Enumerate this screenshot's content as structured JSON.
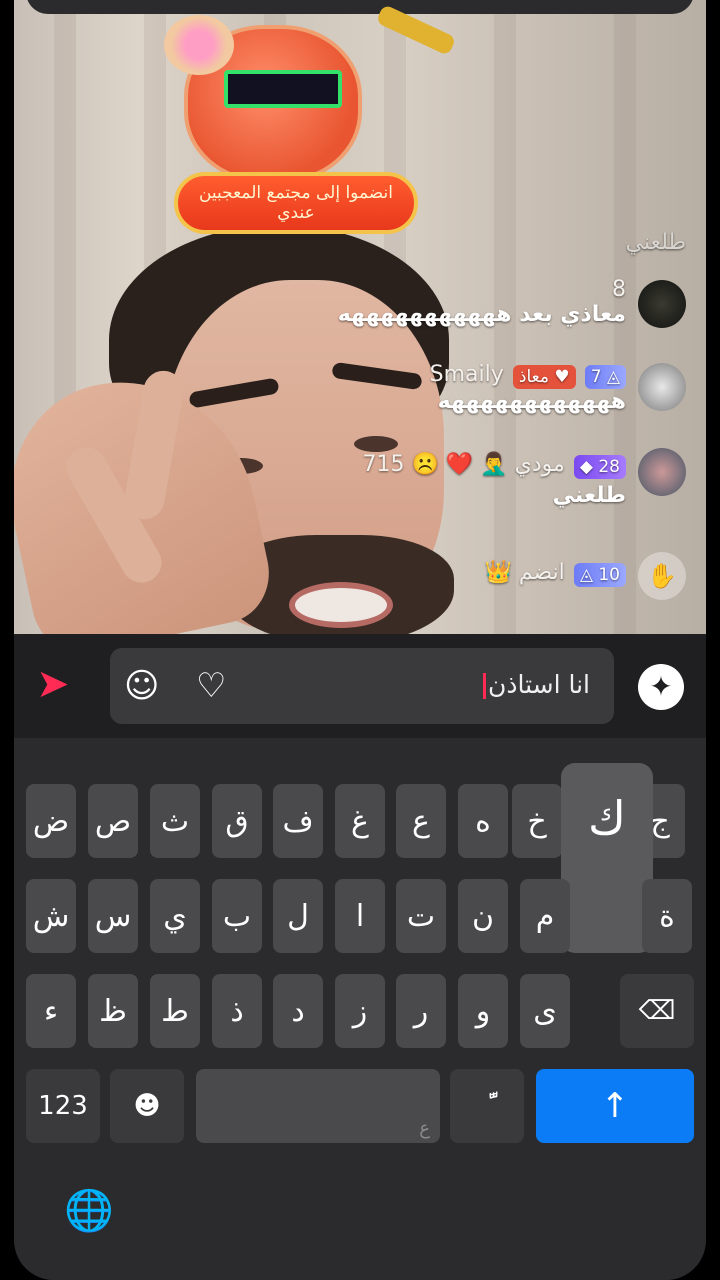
{
  "gift": {
    "banner_line": "انضموا إلى مجتمع المعجبين عندي"
  },
  "comments": [
    {
      "username": "طلعني",
      "text": "",
      "badges": []
    },
    {
      "username": "8",
      "text": "معاذي بعد هههههههههههه",
      "badges": []
    },
    {
      "username": "Smaily",
      "text": "ههههههههههههه",
      "badges": [
        {
          "kind": "level",
          "value": "7"
        },
        {
          "kind": "fan",
          "value": "معاذ"
        }
      ]
    },
    {
      "username": "مودي 🤦‍♂️ ❤️ ☹️ 715",
      "text": "طلعني",
      "badges": [
        {
          "kind": "level",
          "value": "28"
        }
      ]
    },
    {
      "username": "انضم 👑",
      "text": "",
      "badges": [
        {
          "kind": "level",
          "value": "10"
        }
      ]
    }
  ],
  "input_bar": {
    "value": "انا استاذن",
    "send_icon": "send-arrow-icon",
    "emoji_icon": "smiley-icon",
    "heart_icon": "heart-icon",
    "sparkle_icon": "sparkle-icon"
  },
  "keyboard": {
    "row1": [
      "ج",
      "ك",
      "خ",
      "ه",
      "ع",
      "غ",
      "ف",
      "ق",
      "ث",
      "ص",
      "ض"
    ],
    "row2": [
      "ة",
      "",
      "م",
      "ن",
      "ت",
      "ا",
      "ل",
      "ب",
      "ي",
      "س",
      "ش"
    ],
    "row3": [
      "ى",
      "و",
      "ر",
      "ز",
      "د",
      "ذ",
      "ط",
      "ظ",
      "ء"
    ],
    "popup_key": "ك",
    "numbers_label": "123",
    "space_hint": "ع",
    "tanween_key": "ًّ",
    "accent_color": "#0b7cf5"
  }
}
